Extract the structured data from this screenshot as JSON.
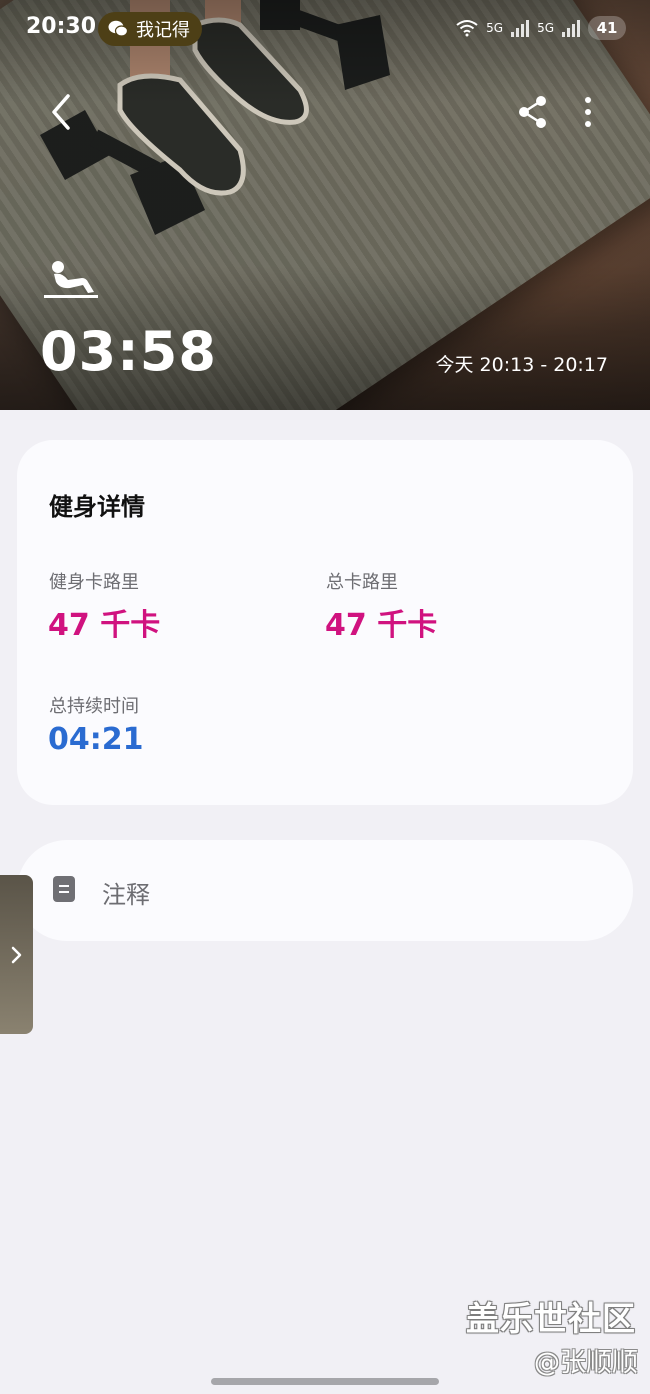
{
  "status_bar": {
    "time": "20:30",
    "app_chip": "我记得",
    "network": [
      "5G",
      "5G"
    ],
    "battery": "41"
  },
  "hero": {
    "duration": "03:58",
    "time_range": "今天 20:13 - 20:17",
    "workout_icon": "sit-up-icon"
  },
  "details": {
    "title": "健身详情",
    "metrics": [
      {
        "label": "健身卡路里",
        "value": "47 千卡"
      },
      {
        "label": "总卡路里",
        "value": "47 千卡"
      },
      {
        "label": "总持续时间",
        "value": "04:21"
      }
    ]
  },
  "notes": {
    "label": "注释"
  },
  "watermark": {
    "line1": "盖乐世社区",
    "line2": "@张顺顺"
  },
  "colors": {
    "calorie": "#d0127f",
    "duration": "#2a6bd1",
    "background": "#f1f0f5",
    "card": "#fbfbfe"
  }
}
